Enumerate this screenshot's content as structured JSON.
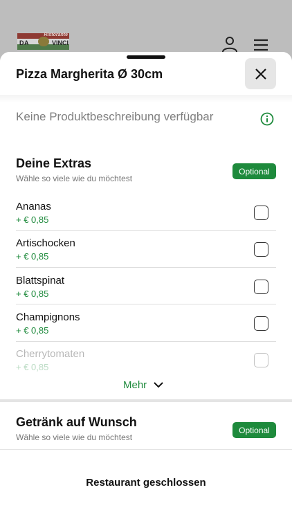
{
  "header": {
    "logo_top": "Ristorante",
    "logo_left": "DA",
    "logo_right": "VINCI",
    "user_icon": "user-icon",
    "menu_icon": "hamburger-menu-icon"
  },
  "sheet": {
    "title": "Pizza Margherita Ø 30cm",
    "close_icon": "close-icon",
    "description": "Keine Produktbeschreibung verfügbar",
    "info_icon": "info-icon"
  },
  "extras": {
    "title": "Deine Extras",
    "subtitle": "Wähle so viele wie du möchtest",
    "badge": "Optional",
    "items": [
      {
        "name": "Ananas",
        "price": "+ € 0,85",
        "checked": false
      },
      {
        "name": "Artischocken",
        "price": "+ € 0,85",
        "checked": false
      },
      {
        "name": "Blattspinat",
        "price": "+ € 0,85",
        "checked": false
      },
      {
        "name": "Champignons",
        "price": "+ € 0,85",
        "checked": false
      },
      {
        "name": "Cherrytomaten",
        "price": "+ € 0,85",
        "checked": false
      }
    ],
    "more_label": "Mehr"
  },
  "drinks": {
    "title": "Getränk auf Wunsch",
    "subtitle": "Wähle so viele wie du möchtest",
    "badge": "Optional"
  },
  "footer": {
    "status": "Restaurant geschlossen"
  },
  "colors": {
    "accent": "#1e8a3c",
    "backdrop": "#a9a9a9"
  }
}
